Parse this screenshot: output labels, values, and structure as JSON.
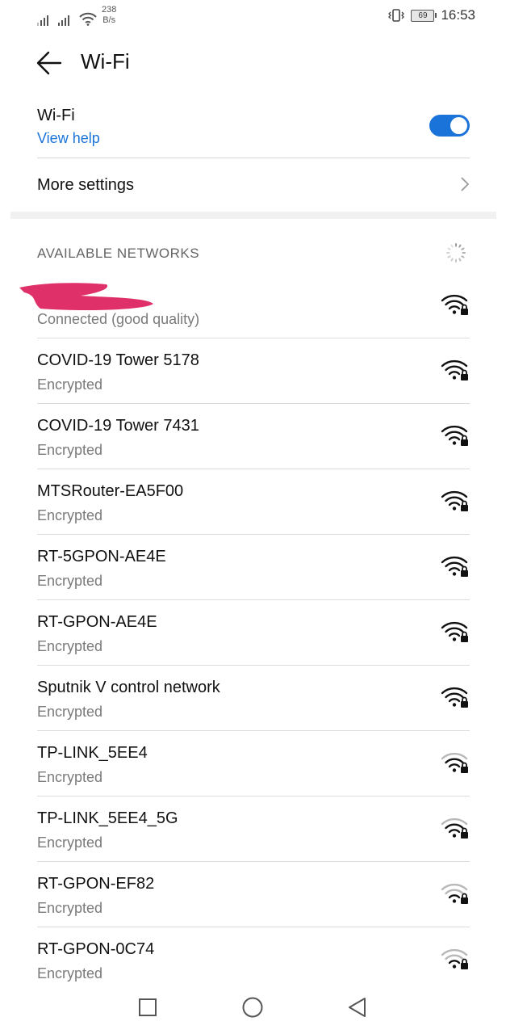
{
  "status_bar": {
    "speed_value": "238",
    "speed_unit": "B/s",
    "battery": "69",
    "time": "16:53"
  },
  "app_bar": {
    "title": "Wi-Fi"
  },
  "wifi_toggle": {
    "label": "Wi-Fi",
    "help_link": "View help",
    "enabled": true,
    "accent_color": "#1a73d9"
  },
  "more_settings": {
    "label": "More settings"
  },
  "available_networks": {
    "header": "AVAILABLE NETWORKS",
    "networks": [
      {
        "name": "",
        "status": "Connected (good quality)",
        "signal": "strong",
        "secured": true
      },
      {
        "name": "COVID-19 Tower 5178",
        "status": "Encrypted",
        "signal": "strong",
        "secured": true
      },
      {
        "name": "COVID-19 Tower 7431",
        "status": "Encrypted",
        "signal": "strong",
        "secured": true
      },
      {
        "name": "MTSRouter-EA5F00",
        "status": "Encrypted",
        "signal": "strong",
        "secured": true
      },
      {
        "name": "RT-5GPON-AE4E",
        "status": "Encrypted",
        "signal": "strong",
        "secured": true
      },
      {
        "name": "RT-GPON-AE4E",
        "status": "Encrypted",
        "signal": "strong",
        "secured": true
      },
      {
        "name": "Sputnik V control network",
        "status": "Encrypted",
        "signal": "strong",
        "secured": true
      },
      {
        "name": "TP-LINK_5EE4",
        "status": "Encrypted",
        "signal": "medium",
        "secured": true
      },
      {
        "name": "TP-LINK_5EE4_5G",
        "status": "Encrypted",
        "signal": "medium",
        "secured": true
      },
      {
        "name": "RT-GPON-EF82",
        "status": "Encrypted",
        "signal": "weak",
        "secured": true
      },
      {
        "name": "RT-GPON-0C74",
        "status": "Encrypted",
        "signal": "weak",
        "secured": true
      }
    ]
  },
  "nav_bar": {
    "buttons": [
      "recent-apps",
      "home",
      "back"
    ]
  }
}
